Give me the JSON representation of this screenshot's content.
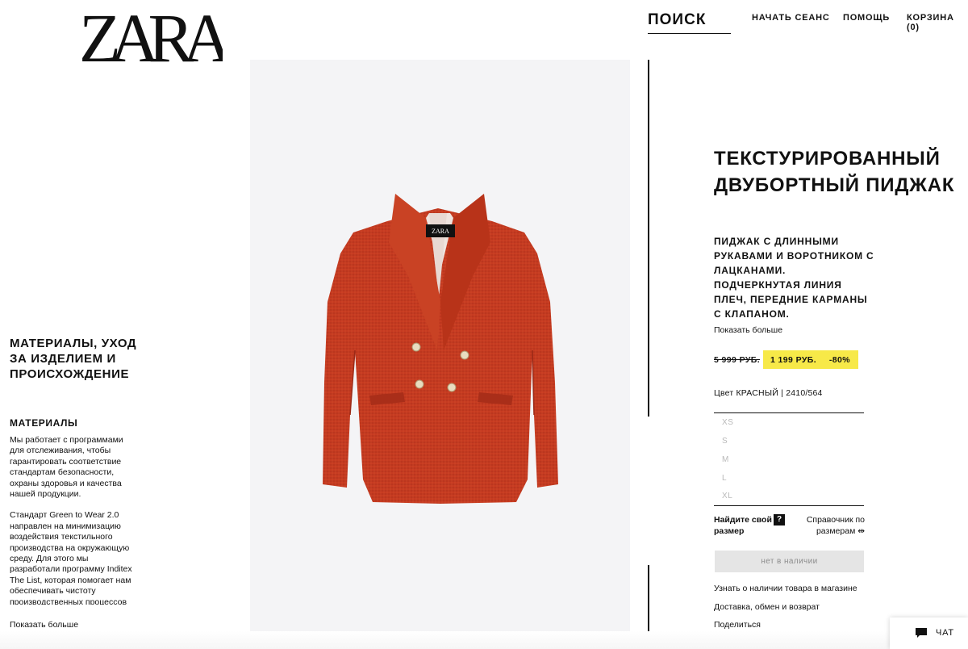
{
  "header": {
    "logo_text": "ZARA",
    "search_label": "ПОИСК",
    "login_label": "НАЧАТЬ СЕАНС",
    "help_label": "ПОМОЩЬ",
    "cart_label": "КОРЗИНА (0)"
  },
  "materials": {
    "heading": "МАТЕРИАЛЫ, УХОД ЗА ИЗДЕЛИЕМ И ПРОИСХОЖДЕНИЕ",
    "subheading": "МАТЕРИАЛЫ",
    "paragraph_1": "Мы работает с программами для отслеживания, чтобы гарантировать соответствие стандартам безопасности, охраны здоровья и качества нашей продукции.",
    "paragraph_2": "Стандарт Green to Wear 2.0 направлен на минимизацию воздействия текстильного производства на окружающую среду. Для этого мы разработали программу Inditex The List, которая помогает нам обеспечивать чистоту производственных процессов",
    "show_more": "Показать больше"
  },
  "product": {
    "title": "ТЕКСТУРИРОВАННЫЙ ДВУБОРТНЫЙ ПИДЖАК",
    "description": "ПИДЖАК С ДЛИННЫМИ РУКАВАМИ И ВОРОТНИКОМ С ЛАЦКАНАМИ. ПОДЧЕРКНУТАЯ ЛИНИЯ ПЛЕЧ, ПЕРЕДНИЕ КАРМАНЫ С КЛАПАНОМ.",
    "show_more": "Показать больше",
    "price_old": "5 999 РУБ.",
    "price_new": "1 199 РУБ.",
    "discount": "-80%",
    "color_line": "Цвет КРАСНЫЙ | 2410/564",
    "image_label": "ZARA",
    "jacket_color": "#c23a20",
    "sizes": [
      "XS",
      "S",
      "M",
      "L",
      "XL"
    ],
    "find_size": "Найдите свой размер",
    "help_badge": "?",
    "size_guide": "Справочник по размерам ⇹",
    "out_of_stock": "нет в наличии",
    "links": {
      "store_availability": "Узнать о наличии товара в магазине",
      "delivery": "Доставка, обмен и возврат",
      "share": "Поделиться"
    }
  },
  "chat": {
    "label": "ЧАТ"
  },
  "colors": {
    "price_highlight": "#f7e948",
    "disabled_button": "#e5e5e5",
    "image_background": "#f4f4f6"
  }
}
